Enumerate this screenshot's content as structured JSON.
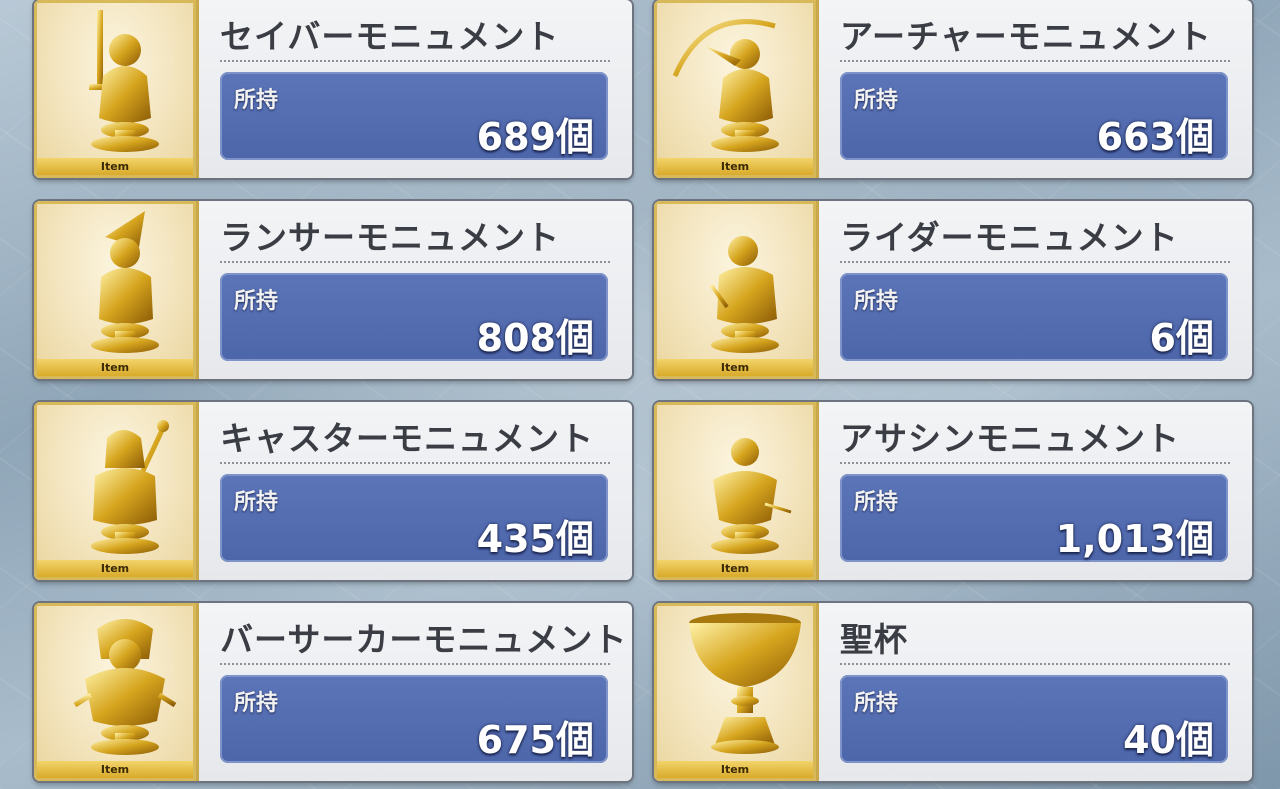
{
  "owned_label": "所持",
  "item_strip_label": "Item",
  "items": [
    {
      "name": "セイバーモニュメント",
      "count": "689個",
      "icon": "saber-monument-icon"
    },
    {
      "name": "アーチャーモニュメント",
      "count": "663個",
      "icon": "archer-monument-icon"
    },
    {
      "name": "ランサーモニュメント",
      "count": "808個",
      "icon": "lancer-monument-icon"
    },
    {
      "name": "ライダーモニュメント",
      "count": "6個",
      "icon": "rider-monument-icon"
    },
    {
      "name": "キャスターモニュメント",
      "count": "435個",
      "icon": "caster-monument-icon"
    },
    {
      "name": "アサシンモニュメント",
      "count": "1,013個",
      "icon": "assassin-monument-icon"
    },
    {
      "name": "バーサーカーモニュメント",
      "count": "675個",
      "icon": "berserker-monument-icon"
    },
    {
      "name": "聖杯",
      "count": "40個",
      "icon": "holy-grail-icon"
    }
  ],
  "colors": {
    "gold": "#d9aa2a",
    "owned_panel": "#5068ad",
    "card_bg": "#eceef1"
  }
}
